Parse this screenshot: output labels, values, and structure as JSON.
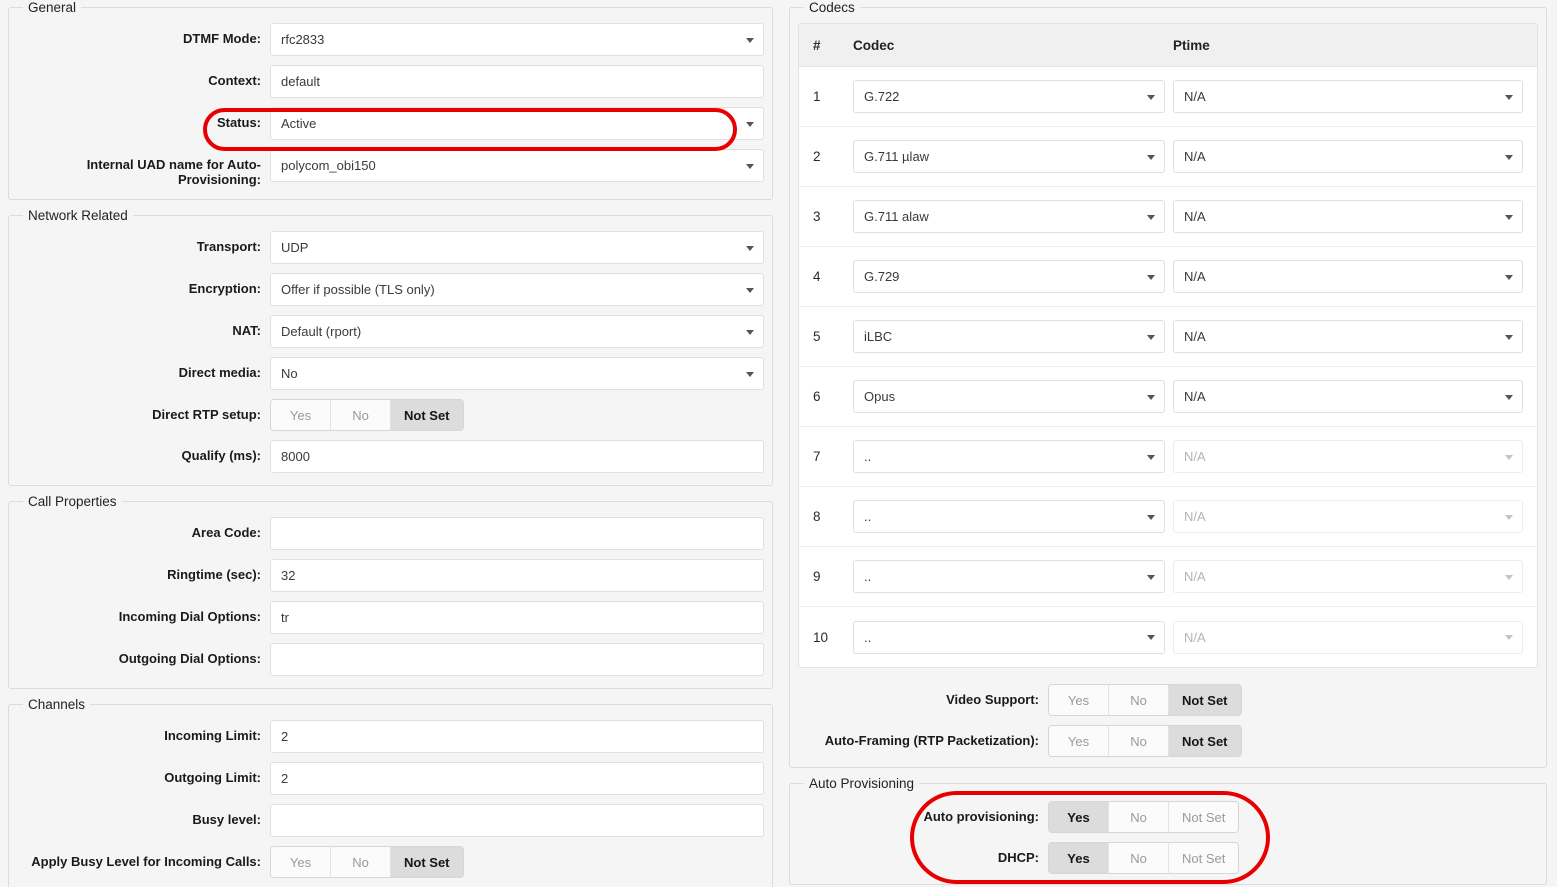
{
  "colors": {
    "highlight": "#e80000",
    "active_toggle_bg": "#dcdcdc",
    "panel_bg": "#f5f5f5"
  },
  "left": {
    "general": {
      "legend": "General",
      "rows": [
        {
          "label": "DTMF Mode:",
          "type": "select",
          "value": "rfc2833"
        },
        {
          "label": "Context:",
          "type": "input",
          "value": "default"
        },
        {
          "label": "Status:",
          "type": "select",
          "value": "Active",
          "highlighted": true
        },
        {
          "label": "Internal UAD name for Auto-Provisioning:",
          "type": "select",
          "value": "polycom_obi150"
        }
      ]
    },
    "network": {
      "legend": "Network Related",
      "rows": [
        {
          "label": "Transport:",
          "type": "select",
          "value": "UDP"
        },
        {
          "label": "Encryption:",
          "type": "select",
          "value": "Offer if possible (TLS only)"
        },
        {
          "label": "NAT:",
          "type": "select",
          "value": "Default (rport)"
        },
        {
          "label": "Direct media:",
          "type": "select",
          "value": "No"
        },
        {
          "label": "Direct RTP setup:",
          "type": "tri",
          "options": [
            "Yes",
            "No",
            "Not Set"
          ],
          "selected": "Not Set"
        },
        {
          "label": "Qualify (ms):",
          "type": "input",
          "value": "8000"
        }
      ]
    },
    "call_properties": {
      "legend": "Call Properties",
      "rows": [
        {
          "label": "Area Code:",
          "type": "input",
          "value": ""
        },
        {
          "label": "Ringtime (sec):",
          "type": "input",
          "value": "32"
        },
        {
          "label": "Incoming Dial Options:",
          "type": "input",
          "value": "tr"
        },
        {
          "label": "Outgoing Dial Options:",
          "type": "input",
          "value": ""
        }
      ]
    },
    "channels": {
      "legend": "Channels",
      "rows": [
        {
          "label": "Incoming Limit:",
          "type": "input",
          "value": "2"
        },
        {
          "label": "Outgoing Limit:",
          "type": "input",
          "value": "2"
        },
        {
          "label": "Busy level:",
          "type": "input",
          "value": ""
        },
        {
          "label": "Apply Busy Level for Incoming Calls:",
          "type": "tri",
          "options": [
            "Yes",
            "No",
            "Not Set"
          ],
          "selected": "Not Set"
        }
      ]
    }
  },
  "right": {
    "codecs": {
      "legend": "Codecs",
      "headers": {
        "num": "#",
        "codec": "Codec",
        "ptime": "Ptime"
      },
      "rows": [
        {
          "num": "1",
          "codec": "G.722",
          "ptime": "N/A",
          "disabled": false
        },
        {
          "num": "2",
          "codec": "G.711 µlaw",
          "ptime": "N/A",
          "disabled": false
        },
        {
          "num": "3",
          "codec": "G.711 alaw",
          "ptime": "N/A",
          "disabled": false
        },
        {
          "num": "4",
          "codec": "G.729",
          "ptime": "N/A",
          "disabled": false
        },
        {
          "num": "5",
          "codec": "iLBC",
          "ptime": "N/A",
          "disabled": false
        },
        {
          "num": "6",
          "codec": "Opus",
          "ptime": "N/A",
          "disabled": false
        },
        {
          "num": "7",
          "codec": "..",
          "ptime": "N/A",
          "disabled": true
        },
        {
          "num": "8",
          "codec": "..",
          "ptime": "N/A",
          "disabled": true
        },
        {
          "num": "9",
          "codec": "..",
          "ptime": "N/A",
          "disabled": true
        },
        {
          "num": "10",
          "codec": "..",
          "ptime": "N/A",
          "disabled": true
        }
      ],
      "toggles": [
        {
          "label": "Video Support:",
          "options": [
            "Yes",
            "No",
            "Not Set"
          ],
          "selected": "Not Set"
        },
        {
          "label": "Auto-Framing (RTP Packetization):",
          "options": [
            "Yes",
            "No",
            "Not Set"
          ],
          "selected": "Not Set"
        }
      ]
    },
    "auto_provisioning": {
      "legend": "Auto Provisioning",
      "highlighted": true,
      "rows": [
        {
          "label": "Auto provisioning:",
          "options": [
            "Yes",
            "No",
            "Not Set"
          ],
          "selected": "Yes"
        },
        {
          "label": "DHCP:",
          "options": [
            "Yes",
            "No",
            "Not Set"
          ],
          "selected": "Yes"
        }
      ]
    }
  }
}
